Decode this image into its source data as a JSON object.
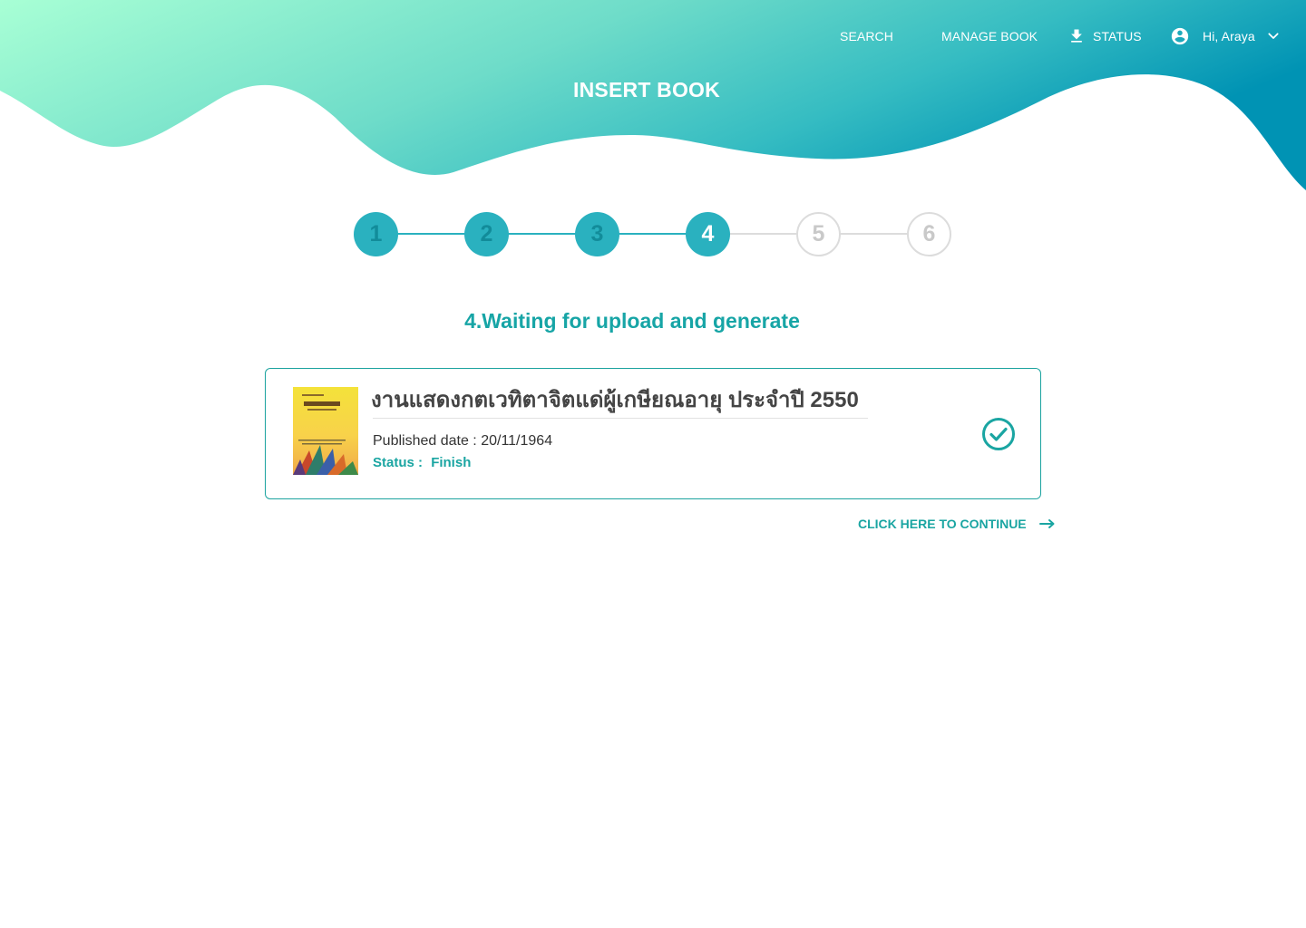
{
  "nav": {
    "search_label": "SEARCH",
    "manage_label": "MANAGE BOOK",
    "status_label": "STATUS",
    "user_label": "Hi, Araya"
  },
  "page_title": "INSERT BOOK",
  "stepper": {
    "steps": [
      {
        "label": "1",
        "state": "done"
      },
      {
        "label": "2",
        "state": "done"
      },
      {
        "label": "3",
        "state": "done"
      },
      {
        "label": "4",
        "state": "current"
      },
      {
        "label": "5",
        "state": "todo"
      },
      {
        "label": "6",
        "state": "todo"
      }
    ]
  },
  "section_title": "4.Waiting for upload and generate",
  "book": {
    "title": "งานแสดงกตเวทิตาจิตแด่ผู้เกษียณอายุ ประจำปี 2550",
    "published_date": "Published date : 20/11/1964",
    "status_label": "Status :",
    "status_value": "Finish"
  },
  "continue_label": "CLICK HERE TO CONTINUE",
  "colors": {
    "accent": "#1aa5a2",
    "step_done": "#2ab1bf",
    "gradient_start": "#a8ffd4",
    "gradient_end": "#0094b5"
  },
  "icons": {
    "status": "download-icon",
    "user": "account-circle-icon",
    "dropdown": "chevron-down-icon",
    "check": "check-circle-icon",
    "continue": "arrow-right-icon"
  }
}
